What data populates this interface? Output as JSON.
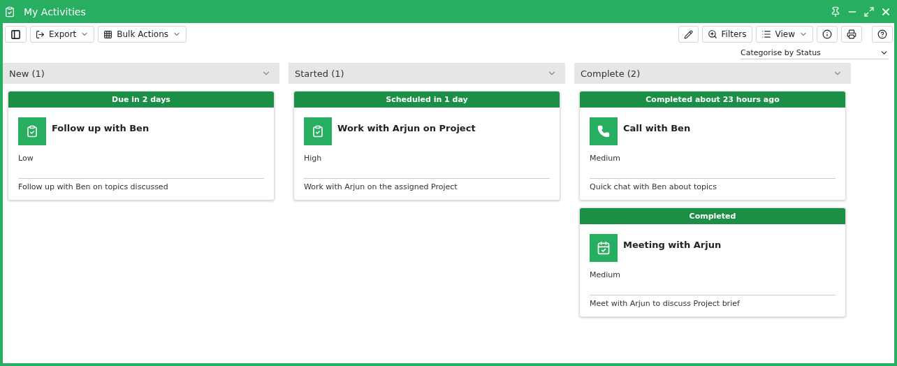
{
  "window": {
    "title": "My Activities"
  },
  "toolbar_left": [
    {
      "kind": "panel"
    },
    {
      "kind": "export",
      "label": "Export"
    },
    {
      "kind": "bulk",
      "label": "Bulk Actions"
    }
  ],
  "toolbar_right": [
    {
      "kind": "edit"
    },
    {
      "kind": "filters",
      "label": "Filters"
    },
    {
      "kind": "view",
      "label": "View"
    },
    {
      "kind": "info"
    },
    {
      "kind": "print"
    },
    {
      "kind": "help"
    }
  ],
  "categorise": {
    "value": "Categorise by Status"
  },
  "columns": [
    {
      "title": "New (1)",
      "cards": [
        {
          "kind": "task",
          "banner": "Due in 2 days",
          "title": "Follow up with Ben",
          "priority": "Low",
          "description": "Follow up with Ben on topics discussed"
        }
      ]
    },
    {
      "title": "Started (1)",
      "cards": [
        {
          "kind": "task",
          "banner": "Scheduled in 1 day",
          "title": "Work with Arjun on Project",
          "priority": "High",
          "description": "Work with Arjun on the assigned Project"
        }
      ]
    },
    {
      "title": "Complete (2)",
      "cards": [
        {
          "kind": "call",
          "banner": "Completed about 23 hours ago",
          "title": "Call with Ben",
          "priority": "Medium",
          "description": "Quick chat with Ben about topics"
        },
        {
          "kind": "meeting",
          "banner": "Completed",
          "title": "Meeting with Arjun",
          "priority": "Medium",
          "description": "Meet with Arjun to discuss Project brief"
        }
      ]
    }
  ]
}
